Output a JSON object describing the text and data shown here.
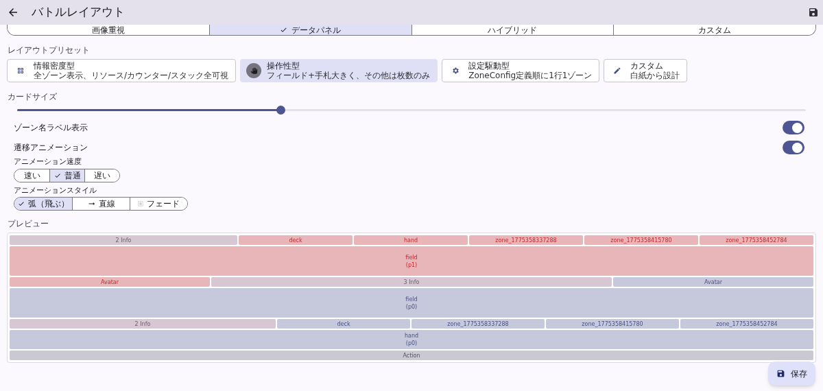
{
  "header": {
    "title": "バトルレイアウト"
  },
  "view_modes": [
    {
      "label": "画像重視",
      "selected": false
    },
    {
      "label": "データパネル",
      "selected": true
    },
    {
      "label": "ハイブリッド",
      "selected": false
    },
    {
      "label": "カスタム",
      "selected": false
    }
  ],
  "preset_section": {
    "title": "レイアウトプリセット",
    "presets": [
      {
        "kind": "grid",
        "name": "情報密度型",
        "description": "全ゾーン表示、リソース/カウンター/スタック全可視",
        "selected": false
      },
      {
        "kind": "hand",
        "name": "操作性型",
        "description": "フィールド+手札大きく、その他は枚数のみ",
        "selected": true
      },
      {
        "kind": "gear",
        "name": "設定駆動型",
        "description": "ZoneConfig定義順に1行1ゾーン",
        "selected": false
      },
      {
        "kind": "pencil",
        "name": "カスタム",
        "description": "白紙から設計",
        "selected": false
      }
    ]
  },
  "card_size": {
    "label": "カードサイズ",
    "level": 0.334
  },
  "toggles": [
    {
      "label": "ゾーン名ラベル表示",
      "on": true
    },
    {
      "label": "遷移アニメーション",
      "on": true
    }
  ],
  "animation_speed": {
    "label": "アニメーション速度",
    "options": [
      {
        "label": "速い",
        "selected": false
      },
      {
        "label": "普通",
        "selected": true
      },
      {
        "label": "遅い",
        "selected": false
      }
    ]
  },
  "animation_style": {
    "label": "アニメーションスタイル",
    "options": [
      {
        "label": "弧（飛ぶ）",
        "selected": true
      },
      {
        "kind": "line",
        "label": "直線",
        "selected": false
      },
      {
        "kind": "fade",
        "label": "フェード",
        "selected": false
      }
    ]
  },
  "preview": {
    "title": "プレビュー",
    "rows": [
      {
        "kind": "strip",
        "zones": [
          {
            "kind": "info",
            "lines": [
              "2 Info"
            ]
          },
          {
            "kind": "p1",
            "lines": [
              "deck"
            ]
          },
          {
            "kind": "p1",
            "lines": [
              "hand"
            ]
          },
          {
            "kind": "p1",
            "lines": [
              "zone_1775358337288"
            ]
          },
          {
            "kind": "p1",
            "lines": [
              "zone_1775358415780"
            ]
          },
          {
            "kind": "p1",
            "lines": [
              "zone_1775358452784"
            ]
          }
        ]
      },
      {
        "kind": "field",
        "zones": [
          {
            "kind": "p1",
            "lines": [
              "field",
              "(p1)"
            ]
          }
        ]
      },
      {
        "kind": "strip",
        "zones": [
          {
            "kind": "p1",
            "lines": [
              "Avatar"
            ]
          },
          {
            "kind": "info",
            "lines": [
              "3 Info"
            ]
          },
          {
            "kind": "p0",
            "lines": [
              "Avatar"
            ]
          }
        ]
      },
      {
        "kind": "field",
        "zones": [
          {
            "kind": "p0",
            "lines": [
              "field",
              "(p0)"
            ]
          }
        ]
      },
      {
        "kind": "strip",
        "zones": [
          {
            "kind": "info",
            "lines": [
              "2 Info"
            ]
          },
          {
            "kind": "p0",
            "lines": [
              "deck"
            ]
          },
          {
            "kind": "p0",
            "lines": [
              "zone_1775358337288"
            ]
          },
          {
            "kind": "p0",
            "lines": [
              "zone_1775358415780"
            ]
          },
          {
            "kind": "p0",
            "lines": [
              "zone_1775358452784"
            ]
          }
        ]
      },
      {
        "kind": "hand",
        "zones": [
          {
            "kind": "p0",
            "lines": [
              "hand",
              "(p0)"
            ]
          }
        ]
      },
      {
        "kind": "strip",
        "zones": [
          {
            "kind": "action",
            "lines": [
              "Action"
            ]
          }
        ]
      }
    ]
  },
  "save_button": {
    "label": "保存"
  }
}
